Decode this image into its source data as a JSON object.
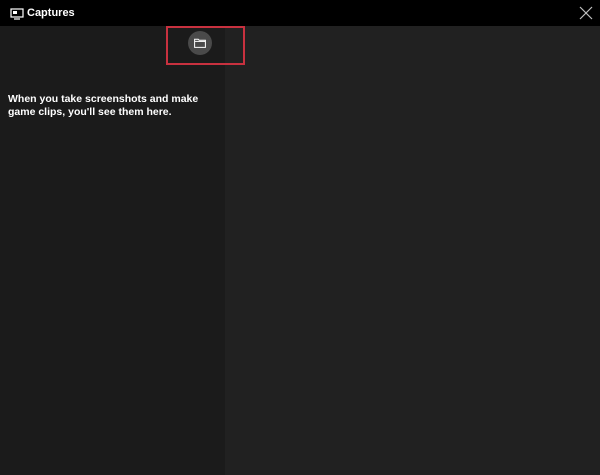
{
  "window": {
    "title": "Captures",
    "title_icon": "captures-monitor-icon",
    "close_icon": "close-icon"
  },
  "captures_panel": {
    "open_folder_icon": "folder-icon",
    "empty_message": "When you take screenshots and make game clips, you'll see them here."
  },
  "colors": {
    "titlebar_bg": "#000000",
    "left_panel_bg": "#1b1b1b",
    "right_panel_bg": "#212121",
    "folder_button_bg": "#4a4a4a",
    "highlight_border": "#c8313f",
    "text": "#ffffff"
  }
}
